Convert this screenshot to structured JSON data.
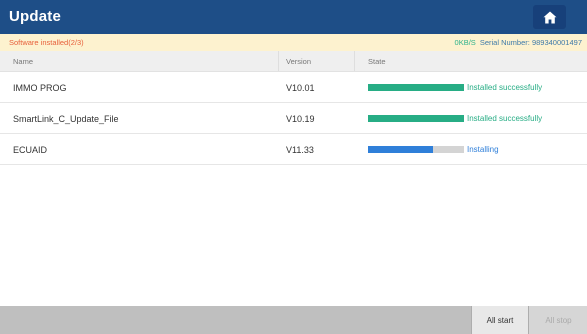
{
  "header": {
    "title": "Update",
    "home_icon": "home-icon"
  },
  "status": {
    "left_text": "Software installed(2/3)",
    "speed": "0KB/S",
    "serial_label": "Serial Number:",
    "serial_number": "989340001497"
  },
  "columns": {
    "name": "Name",
    "version": "Version",
    "state": "State"
  },
  "rows": [
    {
      "name": "IMMO PROG",
      "version": "V10.01",
      "state_text": "Installed successfully",
      "progress": 1.0,
      "color": "#27ad85"
    },
    {
      "name": "SmartLink_C_Update_File",
      "version": "V10.19",
      "state_text": "Installed successfully",
      "progress": 1.0,
      "color": "#27ad85"
    },
    {
      "name": "ECUAID",
      "version": "V11.33",
      "state_text": "Installing",
      "progress": 0.68,
      "color": "#2f7fd9"
    }
  ],
  "footer": {
    "start_label": "All start",
    "stop_label": "All stop"
  },
  "colors": {
    "titlebar": "#1e4e87",
    "status_bg": "#fdf2cf",
    "status_left": "#e7603b",
    "success": "#27ad85",
    "installing": "#2f7fd9"
  }
}
